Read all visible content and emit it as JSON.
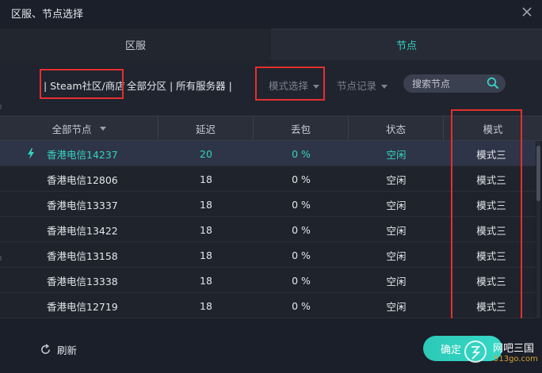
{
  "window": {
    "title": "区服、节点选择"
  },
  "tabs": [
    {
      "label": "区服",
      "active": false
    },
    {
      "label": "节点",
      "active": true
    }
  ],
  "filters": {
    "steam": "| Steam社区/商店",
    "all": "全部分区 | 所有服务器 |",
    "mode_dropdown": "模式选择",
    "record_dropdown": "节点记录",
    "search_placeholder": "搜索节点"
  },
  "table": {
    "columns": [
      "全部节点",
      "延迟",
      "丢包",
      "状态",
      "模式"
    ],
    "rows": [
      {
        "name": "香港电信14237",
        "latency": "20",
        "loss": "0 %",
        "status": "空闲",
        "mode": "模式三",
        "selected": true
      },
      {
        "name": "香港电信12806",
        "latency": "18",
        "loss": "0 %",
        "status": "空闲",
        "mode": "模式三",
        "selected": false
      },
      {
        "name": "香港电信13337",
        "latency": "18",
        "loss": "0 %",
        "status": "空闲",
        "mode": "模式三",
        "selected": false
      },
      {
        "name": "香港电信13422",
        "latency": "18",
        "loss": "0 %",
        "status": "空闲",
        "mode": "模式三",
        "selected": false
      },
      {
        "name": "香港电信13158",
        "latency": "18",
        "loss": "0 %",
        "status": "空闲",
        "mode": "模式三",
        "selected": false
      },
      {
        "name": "香港电信13338",
        "latency": "18",
        "loss": "0 %",
        "status": "空闲",
        "mode": "模式三",
        "selected": false
      },
      {
        "name": "香港电信12719",
        "latency": "18",
        "loss": "0 %",
        "status": "空闲",
        "mode": "模式三",
        "selected": false
      }
    ]
  },
  "footer": {
    "refresh": "刷新",
    "confirm": "确定"
  },
  "watermark": {
    "name": "网吧三国",
    "url": "513go.com"
  },
  "colors": {
    "accent": "#35d2c2",
    "highlight_box": "#e2302f",
    "background": "#1b1f29"
  }
}
